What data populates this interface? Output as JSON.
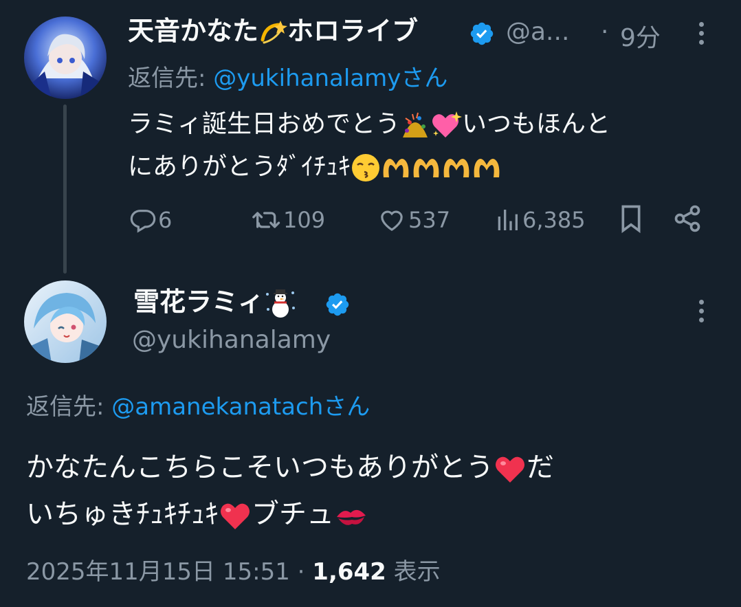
{
  "tweet1": {
    "name": "天音かなた",
    "name_suffix": "ホロライブ",
    "handle": "@a...",
    "time": "9分",
    "reply_prefix": "返信先: ",
    "reply_to": "@yukihanalamyさん",
    "text_line1_a": "ラミィ誕生日おめでとう",
    "text_line1_b": "いつもほんと",
    "text_line2_a": "にありがとうﾀﾞｲﾁｭｷ",
    "actions": {
      "replies": "6",
      "retweets": "109",
      "likes": "537",
      "views": "6,385"
    },
    "emojis": [
      "dizzy",
      "confetti-ball",
      "sparkling-heart",
      "kissing-face",
      "heart-hands"
    ]
  },
  "tweet2": {
    "name": "雪花ラミィ",
    "handle": "@yukihanalamy",
    "reply_prefix": "返信先: ",
    "reply_to": "@amanekanatachさん",
    "text_line1_a": "かなたんこちらこそいつもありがとう",
    "text_line1_b": "だ",
    "text_line2_a": "いちゅきﾁｭｷﾁｭｷ",
    "text_line2_b": "ブチュ",
    "footer_date": "2025年11月15日 15:51",
    "footer_views": "1,642",
    "footer_views_label": "表示",
    "emojis": [
      "snowman",
      "red-heart",
      "kiss-mark"
    ]
  },
  "colors": {
    "background": "#15202b",
    "text": "#f7f9f9",
    "secondary": "#8b98a5",
    "link": "#1d9bf0",
    "thread_line": "#38444d"
  }
}
